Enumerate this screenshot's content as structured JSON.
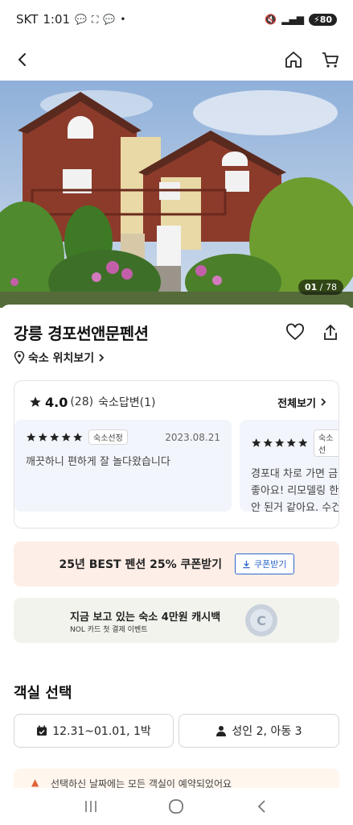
{
  "status_bar": {
    "carrier": "SKT",
    "time": "1:01",
    "battery": "80"
  },
  "hero": {
    "counter_current": "01",
    "counter_total": "/ 78"
  },
  "property": {
    "title": "강릉 경포썬앤문펜션",
    "location_link": "숙소 위치보기"
  },
  "reviews": {
    "rating": "4.0",
    "count": "(28)",
    "reply_label": "숙소답변(1)",
    "see_all": "전체보기",
    "items": [
      {
        "badge": "숙소선정",
        "date": "2023.08.21",
        "text": "깨끗하니 편하게 잘 놀다왔습니다"
      },
      {
        "badge": "숙소선",
        "text": "경포대 차로 가면 금\n좋아요! 리모델링 한\n안 된거 같아요. 수건"
      }
    ]
  },
  "coupon_banner": {
    "text": "25년 BEST 펜션 25% 쿠폰받기",
    "button": "쿠폰받기"
  },
  "cashback_banner": {
    "title": "지금 보고 있는 숙소 4만원 캐시백",
    "subtitle": "NOL 카드 첫 결제 이벤트"
  },
  "room_select": {
    "title": "객실 선택",
    "date_range": "12.31~01.01, 1박",
    "guests": "성인 2, 아동 3"
  },
  "notice": {
    "text": "선택하신 날짜에는 모든 객실이 예약되었어요"
  },
  "colors": {
    "accent_blue": "#2d67c9",
    "coupon_bg": "#fdeee7",
    "review_item_bg": "#f2f5fb"
  }
}
